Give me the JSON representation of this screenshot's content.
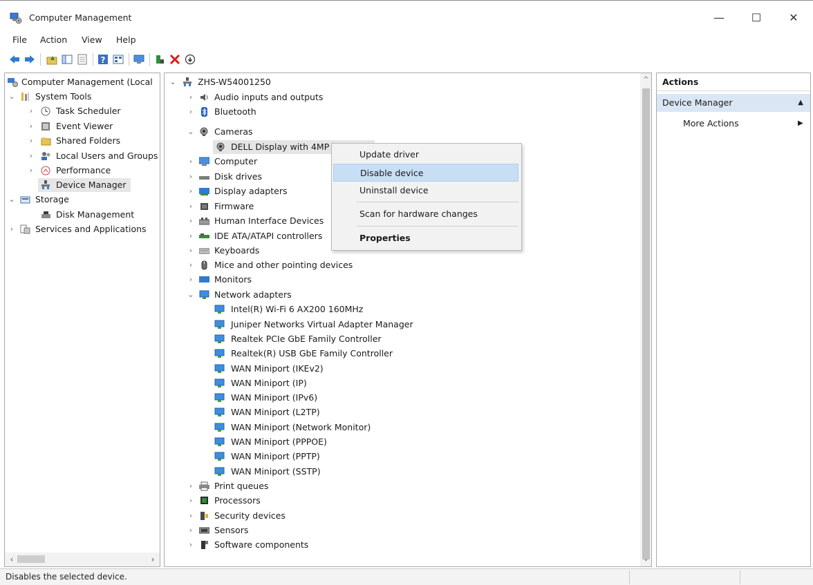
{
  "window": {
    "title": "Computer Management",
    "controls": {
      "minimize": "—",
      "maximize": "☐",
      "close": "✕"
    }
  },
  "menu": [
    "File",
    "Action",
    "View",
    "Help"
  ],
  "toolbar": [
    "back-icon",
    "forward-icon",
    "up-folder-icon",
    "show-hide-tree-icon",
    "properties-icon",
    "help-icon",
    "view-icon",
    "computer-icon",
    "update-driver-icon",
    "uninstall-icon",
    "disable-icon"
  ],
  "left_tree": {
    "root": "Computer Management (Local",
    "system_tools": "System Tools",
    "task_scheduler": "Task Scheduler",
    "event_viewer": "Event Viewer",
    "shared_folders": "Shared Folders",
    "local_users": "Local Users and Groups",
    "performance": "Performance",
    "device_manager": "Device Manager",
    "storage": "Storage",
    "disk_management": "Disk Management",
    "services": "Services and Applications"
  },
  "device_tree": {
    "computer_name": "ZHS-W54001250",
    "audio": "Audio inputs and outputs",
    "bluetooth": "Bluetooth",
    "cameras": "Cameras",
    "camera_device": "DELL Display with 4MP",
    "computer": "Computer",
    "disk_drives": "Disk drives",
    "display_adapters": "Display adapters",
    "firmware": "Firmware",
    "hid": "Human Interface Devices",
    "ide": "IDE ATA/ATAPI controllers",
    "keyboards": "Keyboards",
    "mice": "Mice and other pointing devices",
    "monitors": "Monitors",
    "network_adapters": "Network adapters",
    "network_devices": [
      "Intel(R) Wi-Fi 6 AX200 160MHz",
      "Juniper Networks Virtual Adapter Manager",
      "Realtek PCIe GbE Family Controller",
      "Realtek(R) USB GbE Family Controller",
      "WAN Miniport (IKEv2)",
      "WAN Miniport (IP)",
      "WAN Miniport (IPv6)",
      "WAN Miniport (L2TP)",
      "WAN Miniport (Network Monitor)",
      "WAN Miniport (PPPOE)",
      "WAN Miniport (PPTP)",
      "WAN Miniport (SSTP)"
    ],
    "print_queues": "Print queues",
    "processors": "Processors",
    "security_devices": "Security devices",
    "sensors": "Sensors",
    "software_components": "Software components"
  },
  "context_menu": {
    "update_driver": "Update driver",
    "disable_device": "Disable device",
    "uninstall_device": "Uninstall device",
    "scan": "Scan for hardware changes",
    "properties": "Properties"
  },
  "actions": {
    "header": "Actions",
    "section": "Device Manager",
    "more": "More Actions"
  },
  "status": {
    "text": "Disables the selected device."
  },
  "colors": {
    "selection": "#c7def5",
    "section_bg": "#dbe6f4",
    "tree_selected": "#e6e6e6"
  }
}
